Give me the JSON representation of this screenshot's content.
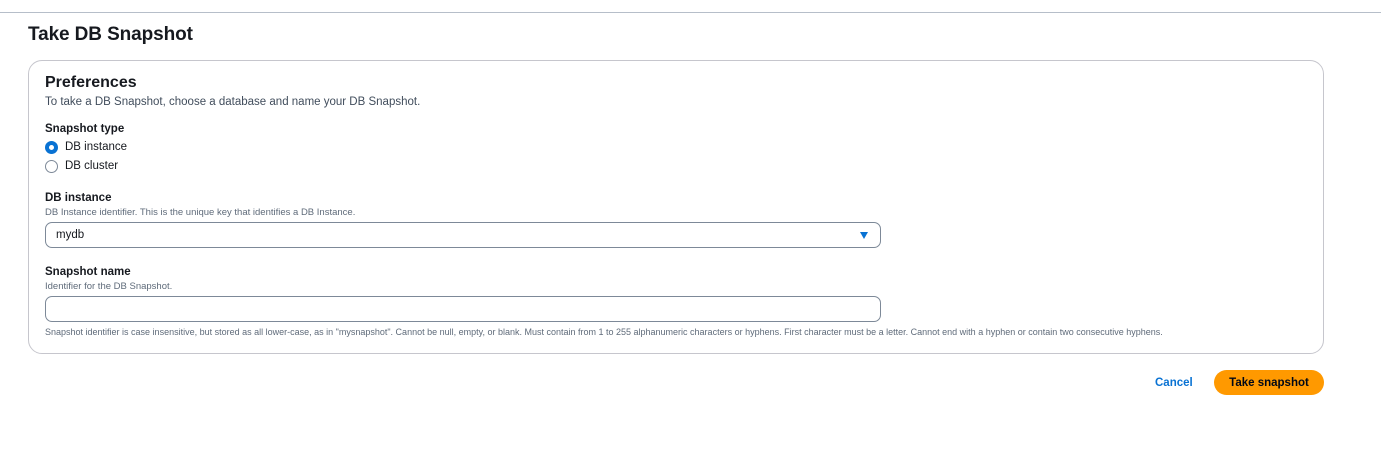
{
  "page": {
    "title": "Take DB Snapshot"
  },
  "preferences": {
    "title": "Preferences",
    "description": "To take a DB Snapshot, choose a database and name your DB Snapshot.",
    "snapshot_type": {
      "label": "Snapshot type",
      "options": [
        {
          "label": "DB instance",
          "selected": true
        },
        {
          "label": "DB cluster",
          "selected": false
        }
      ]
    },
    "db_instance": {
      "label": "DB instance",
      "hint": "DB Instance identifier. This is the unique key that identifies a DB Instance.",
      "selected_value": "mydb",
      "caret_icon": "caret-down-icon"
    },
    "snapshot_name": {
      "label": "Snapshot name",
      "hint": "Identifier for the DB Snapshot.",
      "value": "",
      "constraint": "Snapshot identifier is case insensitive, but stored as all lower-case, as in \"mysnapshot\". Cannot be null, empty, or blank. Must contain from 1 to 255 alphanumeric characters or hyphens. First character must be a letter. Cannot end with a hyphen or contain two consecutive hyphens."
    }
  },
  "actions": {
    "cancel_label": "Cancel",
    "submit_label": "Take snapshot"
  },
  "colors": {
    "accent": "#0972d3",
    "primary_button": "#ff9900",
    "text": "#16191f"
  }
}
